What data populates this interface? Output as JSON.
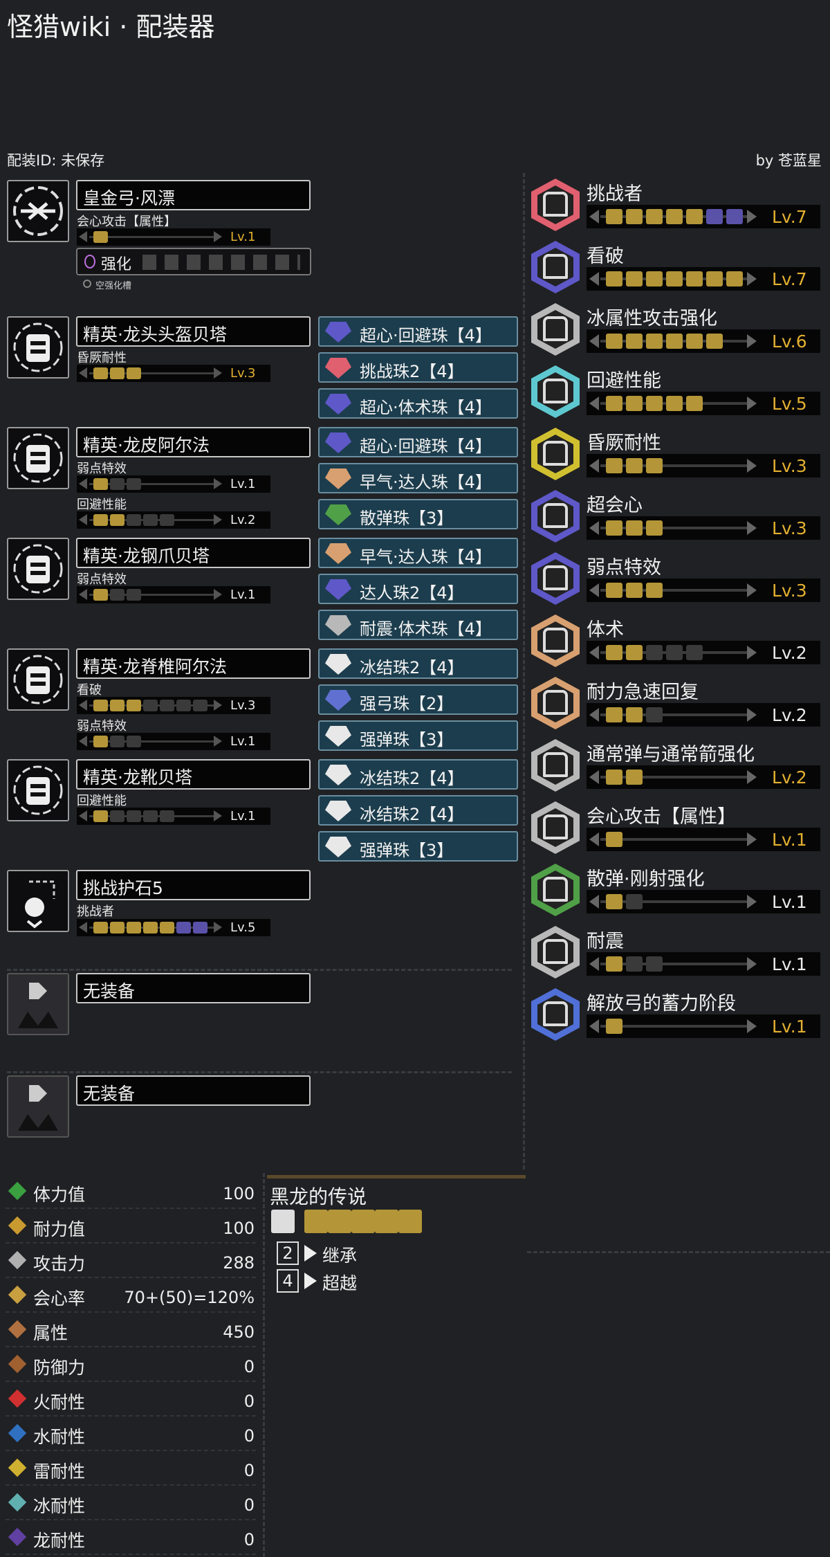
{
  "header": {
    "title": "怪猎wiki · 配装器",
    "id_label": "配装ID: 未保存",
    "author": "by 苍蓝星"
  },
  "weapon": {
    "name": "皇金弓·风漂",
    "skill": {
      "name": "会心攻击【属性】",
      "level": "Lv.1",
      "max": 5,
      "on": 1
    },
    "augment_label": "强化",
    "empty_augment": "空强化槽"
  },
  "armor": [
    {
      "name": "精英·龙头头盔贝塔",
      "skills": [
        {
          "name": "昏厥耐性",
          "level": "Lv.3",
          "gold": true,
          "max": 3,
          "on": 3
        }
      ],
      "decos": [
        "超心·回避珠【4】",
        "挑战珠2【4】",
        "超心·体术珠【4】"
      ]
    },
    {
      "name": "精英·龙皮阿尔法",
      "skills": [
        {
          "name": "弱点特效",
          "level": "Lv.1",
          "gold": false,
          "max": 3,
          "on": 1
        },
        {
          "name": "回避性能",
          "level": "Lv.2",
          "gold": false,
          "max": 5,
          "on": 2
        }
      ],
      "decos": [
        "超心·回避珠【4】",
        "早气·达人珠【4】",
        "散弹珠【3】"
      ]
    },
    {
      "name": "精英·龙钢爪贝塔",
      "skills": [
        {
          "name": "弱点特效",
          "level": "Lv.1",
          "gold": false,
          "max": 3,
          "on": 1
        }
      ],
      "decos": [
        "早气·达人珠【4】",
        "达人珠2【4】",
        "耐震·体术珠【4】"
      ]
    },
    {
      "name": "精英·龙脊椎阿尔法",
      "skills": [
        {
          "name": "看破",
          "level": "Lv.3",
          "gold": false,
          "max": 7,
          "on": 3
        },
        {
          "name": "弱点特效",
          "level": "Lv.1",
          "gold": false,
          "max": 3,
          "on": 1
        }
      ],
      "decos": [
        "冰结珠2【4】",
        "强弓珠【2】",
        "强弹珠【3】"
      ]
    },
    {
      "name": "精英·龙靴贝塔",
      "skills": [
        {
          "name": "回避性能",
          "level": "Lv.1",
          "gold": false,
          "max": 5,
          "on": 1
        }
      ],
      "decos": [
        "冰结珠2【4】",
        "冰结珠2【4】",
        "强弹珠【3】"
      ]
    }
  ],
  "charm": {
    "name": "挑战护石5",
    "skill": {
      "name": "挑战者",
      "level": "Lv.5",
      "max": 7,
      "on": 5
    }
  },
  "empty_slots": [
    "无装备",
    "无装备"
  ],
  "skill_summary": [
    {
      "name": "挑战者",
      "level": "Lv.7",
      "gold": true,
      "max": 7,
      "on": 5,
      "extra": 2,
      "color": "#e06070"
    },
    {
      "name": "看破",
      "level": "Lv.7",
      "gold": true,
      "max": 7,
      "on": 7,
      "extra": 0,
      "color": "#5e58c8"
    },
    {
      "name": "冰属性攻击强化",
      "level": "Lv.6",
      "gold": true,
      "max": 6,
      "on": 6,
      "extra": 0,
      "color": "#b8b8b8"
    },
    {
      "name": "回避性能",
      "level": "Lv.5",
      "gold": true,
      "max": 5,
      "on": 5,
      "extra": 0,
      "color": "#5ec8d0"
    },
    {
      "name": "昏厥耐性",
      "level": "Lv.3",
      "gold": true,
      "max": 3,
      "on": 3,
      "extra": 0,
      "color": "#d0c030"
    },
    {
      "name": "超会心",
      "level": "Lv.3",
      "gold": true,
      "max": 3,
      "on": 3,
      "extra": 0,
      "color": "#5e58c8"
    },
    {
      "name": "弱点特效",
      "level": "Lv.3",
      "gold": true,
      "max": 3,
      "on": 3,
      "extra": 0,
      "color": "#5e58c8"
    },
    {
      "name": "体术",
      "level": "Lv.2",
      "gold": false,
      "max": 5,
      "on": 2,
      "extra": 0,
      "color": "#d8a070"
    },
    {
      "name": "耐力急速回复",
      "level": "Lv.2",
      "gold": false,
      "max": 3,
      "on": 2,
      "extra": 0,
      "color": "#d8a070"
    },
    {
      "name": "通常弹与通常箭强化",
      "level": "Lv.2",
      "gold": true,
      "max": 2,
      "on": 2,
      "extra": 0,
      "color": "#b8b8b8"
    },
    {
      "name": "会心攻击【属性】",
      "level": "Lv.1",
      "gold": true,
      "max": 1,
      "on": 1,
      "extra": 0,
      "color": "#b8b8b8"
    },
    {
      "name": "散弹·刚射强化",
      "level": "Lv.1",
      "gold": false,
      "max": 2,
      "on": 1,
      "extra": 0,
      "color": "#50a048"
    },
    {
      "name": "耐震",
      "level": "Lv.1",
      "gold": false,
      "max": 3,
      "on": 1,
      "extra": 0,
      "color": "#b8b8b8"
    },
    {
      "name": "解放弓的蓄力阶段",
      "level": "Lv.1",
      "gold": true,
      "max": 1,
      "on": 1,
      "extra": 0,
      "color": "#5070d8"
    }
  ],
  "stats": [
    {
      "label": "体力值",
      "value": "100",
      "icon": "health-icon",
      "color": "#3aa040"
    },
    {
      "label": "耐力值",
      "value": "100",
      "icon": "stamina-icon",
      "color": "#c89a30"
    },
    {
      "label": "攻击力",
      "value": "288",
      "icon": "attack-icon",
      "color": "#b0b0b0"
    },
    {
      "label": "会心率",
      "value": "70+(50)=120%",
      "icon": "affinity-icon",
      "color": "#c8a040"
    },
    {
      "label": "属性",
      "value": "450",
      "icon": "element-icon",
      "color": "#b07040"
    },
    {
      "label": "防御力",
      "value": "0",
      "icon": "defense-icon",
      "color": "#a06030"
    },
    {
      "label": "火耐性",
      "value": "0",
      "icon": "fire-icon",
      "color": "#d03030"
    },
    {
      "label": "水耐性",
      "value": "0",
      "icon": "water-icon",
      "color": "#3070c0"
    },
    {
      "label": "雷耐性",
      "value": "0",
      "icon": "thunder-icon",
      "color": "#d0b030"
    },
    {
      "label": "冰耐性",
      "value": "0",
      "icon": "ice-icon",
      "color": "#60b0b0"
    },
    {
      "label": "龙耐性",
      "value": "0",
      "icon": "dragon-icon",
      "color": "#6040a0"
    }
  ],
  "set_bonus": {
    "title": "黑龙的传说",
    "bonuses": [
      {
        "count": "2",
        "name": "继承"
      },
      {
        "count": "4",
        "name": "超越"
      }
    ]
  },
  "colors": {
    "gold": "#e3b030",
    "deco_bg": "#1c3d4d",
    "bg": "#202124"
  }
}
